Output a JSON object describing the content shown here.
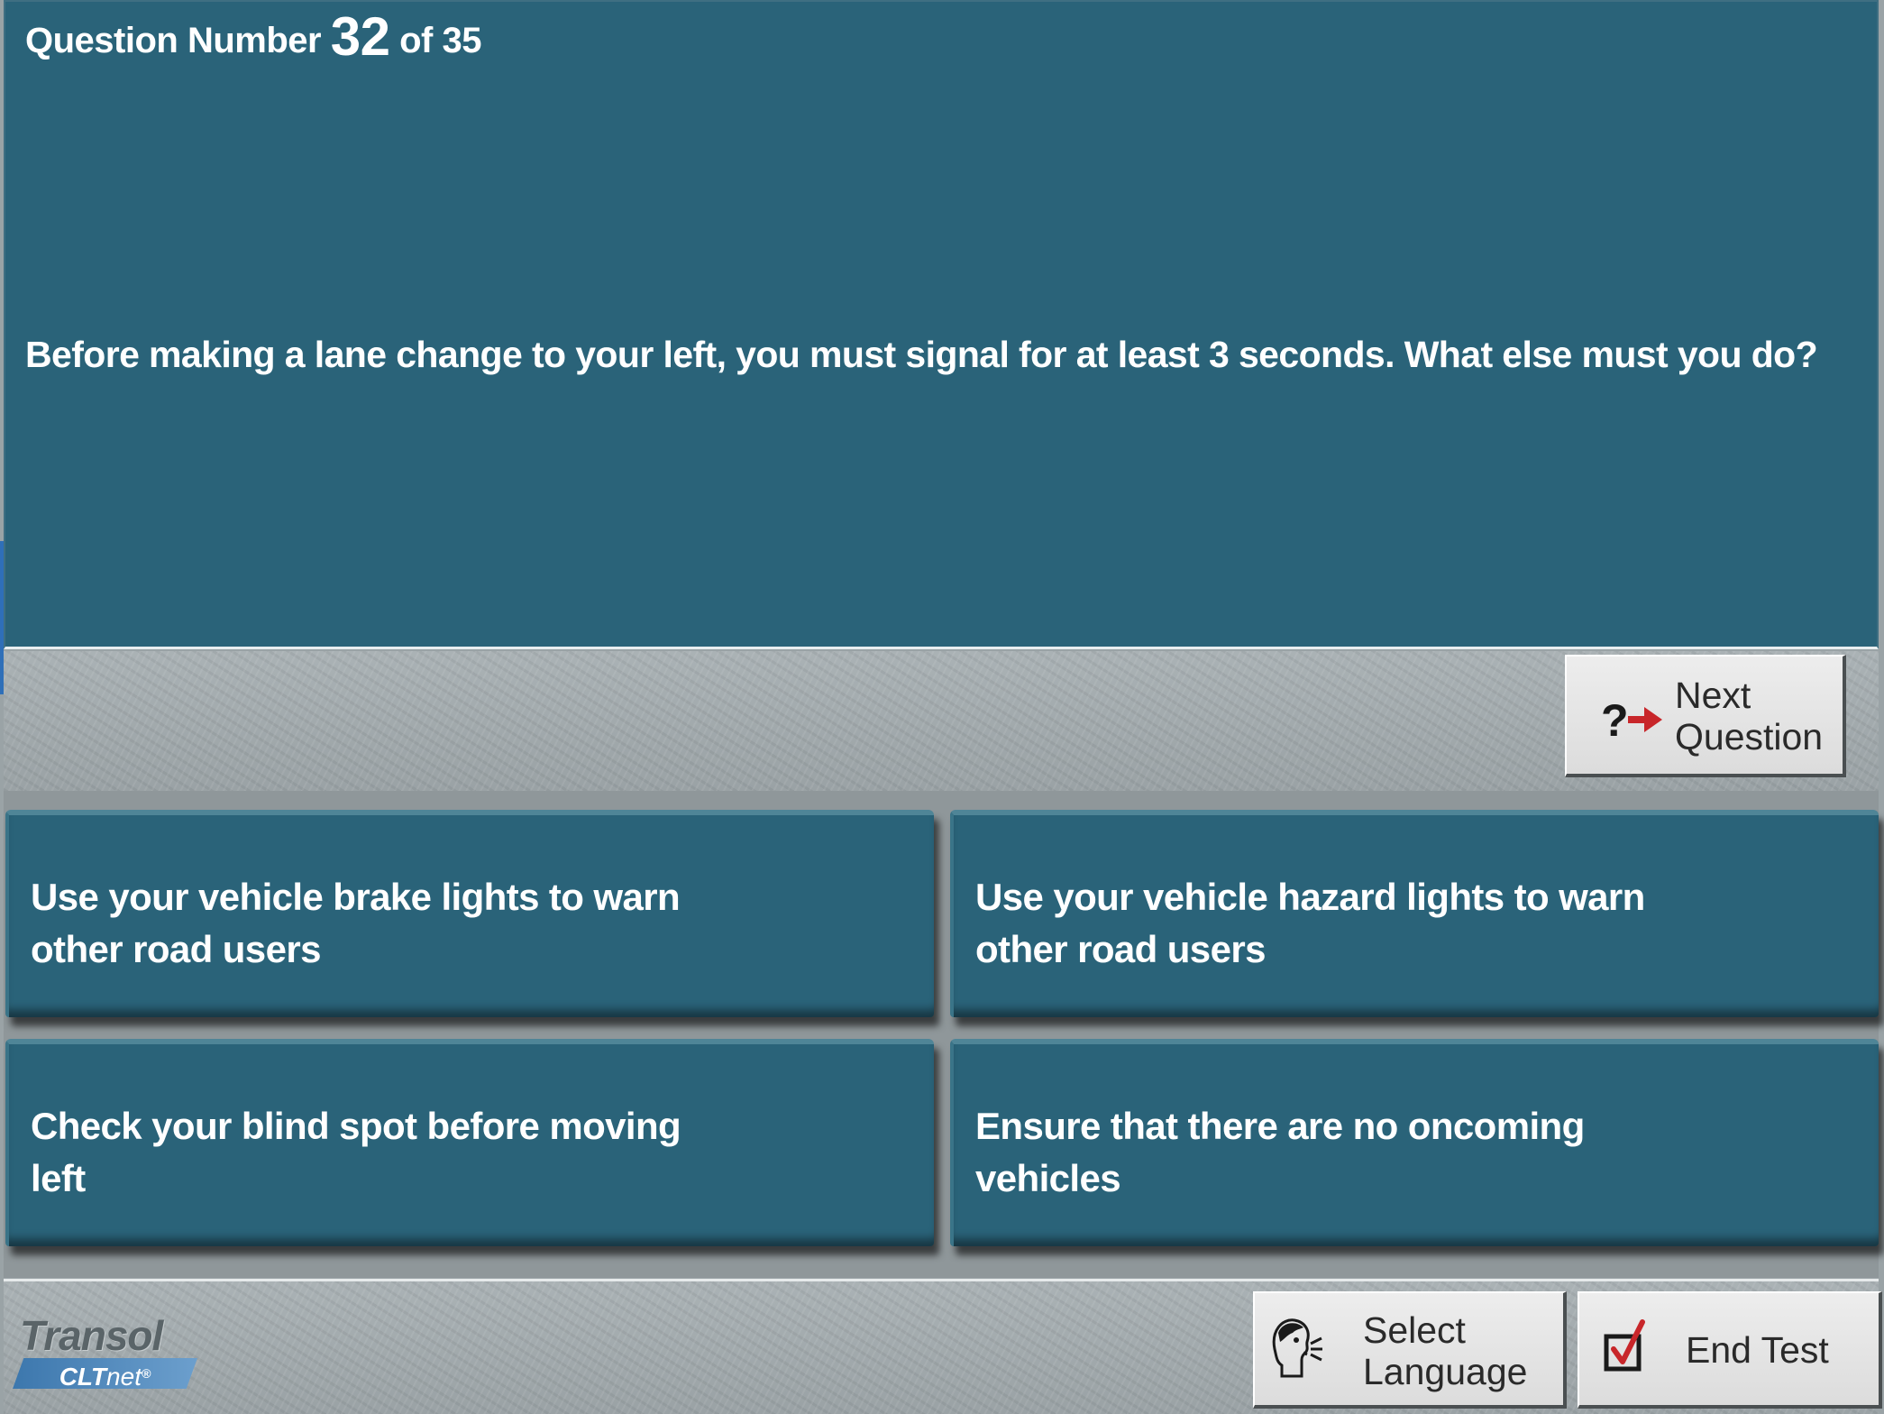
{
  "question": {
    "counter_prefix": "Question Number",
    "number": "32",
    "counter_suffix": "of 35",
    "text": "Before making a lane change to your left, you must signal for at least 3 seconds. What else must you do?"
  },
  "nav": {
    "next_question_line1": "Next",
    "next_question_line2": "Question",
    "next_icon": "question-arrow-icon"
  },
  "answers": [
    {
      "line1": "Use your vehicle brake lights to warn",
      "line2": "other road users"
    },
    {
      "line1": "Use your vehicle hazard lights to warn",
      "line2": "other road users"
    },
    {
      "line1": "Check your blind spot before moving",
      "line2": "left"
    },
    {
      "line1": "Ensure that there are no oncoming",
      "line2": "vehicles"
    }
  ],
  "footer": {
    "brand_name": "Transol",
    "brand_sub": "CLT",
    "brand_sub2": "net",
    "brand_mark": "®",
    "select_language_line1": "Select",
    "select_language_line2": "Language",
    "select_language_icon": "speaking-head-icon",
    "end_test_label": "End Test",
    "end_test_icon": "checkbox-check-icon"
  },
  "colors": {
    "panel": "#2a6379",
    "button_face": "#e4e4e4",
    "accent_red": "#c8262a",
    "background": "#a3abae"
  }
}
